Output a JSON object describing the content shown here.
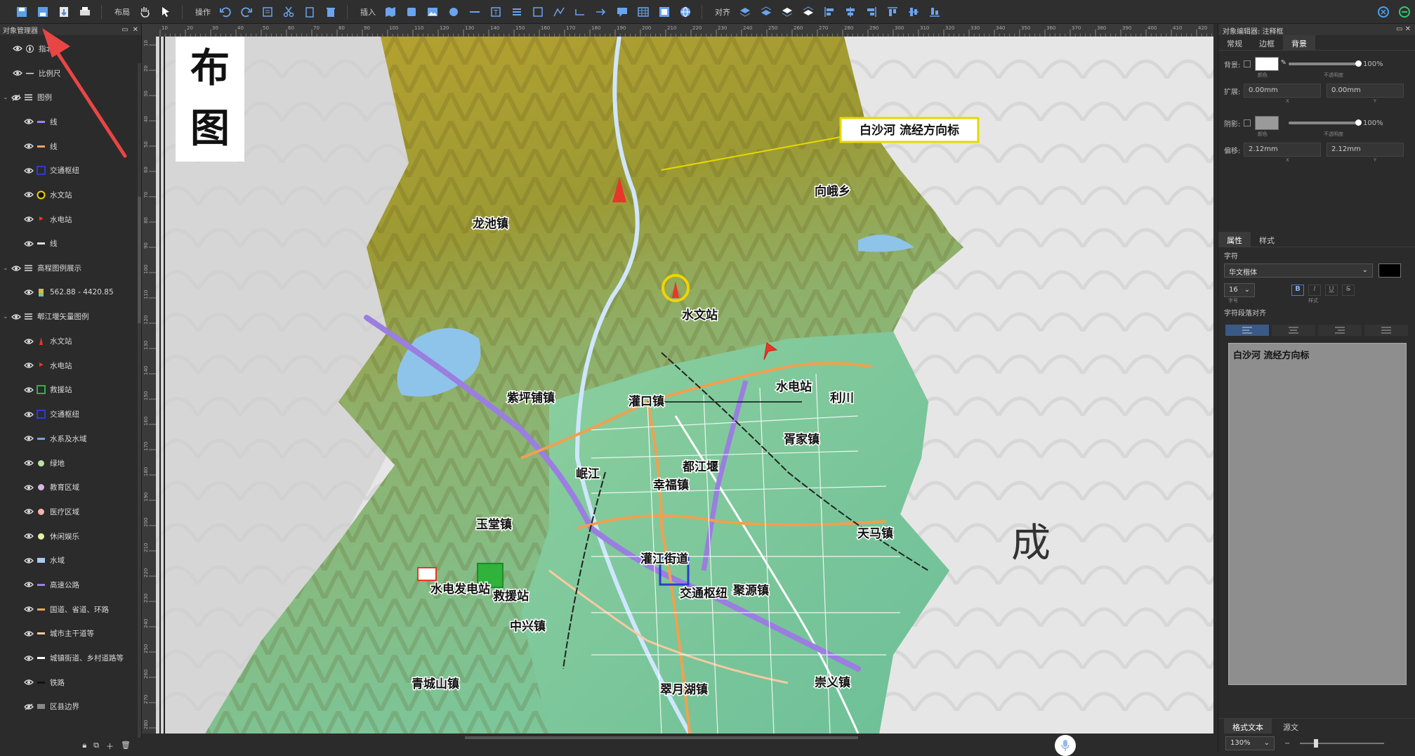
{
  "toolbar": {
    "layout_label": "布局",
    "operate_label": "操作",
    "insert_label": "插入",
    "align_label": "对齐"
  },
  "left_panel": {
    "title": "对象管理器",
    "items": [
      {
        "label": "指北针",
        "icon": "compass-icon",
        "indent": 1,
        "caret": false,
        "swatch": "compass"
      },
      {
        "label": "比例尺",
        "icon": "scalebar-icon",
        "indent": 1,
        "caret": false,
        "swatch": "scale"
      },
      {
        "label": "图例",
        "icon": "legend-icon",
        "indent": 0,
        "caret": true,
        "swatch": "list",
        "hidden": true
      },
      {
        "label": "线",
        "indent": 2,
        "swatch": "line",
        "color": "#9e84ff"
      },
      {
        "label": "线",
        "indent": 2,
        "swatch": "line",
        "color": "#f2a36c"
      },
      {
        "label": "交通枢纽",
        "indent": 2,
        "swatch": "box",
        "color": "#2e3dc7"
      },
      {
        "label": "水文站",
        "indent": 2,
        "swatch": "circle",
        "color": "#f2d400"
      },
      {
        "label": "水电站",
        "indent": 2,
        "swatch": "flag",
        "color": "#e8362a"
      },
      {
        "label": "线",
        "indent": 2,
        "swatch": "line",
        "color": "#dddddd"
      },
      {
        "label": "高程图例展示",
        "indent": 0,
        "caret": true,
        "swatch": "list"
      },
      {
        "label": "562.88 - 4420.85",
        "indent": 2,
        "swatch": "ramp",
        "color": "#d9b93a"
      },
      {
        "label": "郫江堰矢量图例",
        "indent": 0,
        "caret": true,
        "swatch": "list"
      },
      {
        "label": "水文站",
        "indent": 2,
        "swatch": "pin",
        "color": "#e8362a"
      },
      {
        "label": "水电站",
        "indent": 2,
        "swatch": "flag",
        "color": "#e8362a"
      },
      {
        "label": "救援站",
        "indent": 2,
        "swatch": "box",
        "color": "#2fb33b"
      },
      {
        "label": "交通枢纽",
        "indent": 2,
        "swatch": "box",
        "color": "#2e3dc7"
      },
      {
        "label": "水系及水域",
        "indent": 2,
        "swatch": "line",
        "color": "#6fa6e0"
      },
      {
        "label": "绿地",
        "indent": 2,
        "swatch": "dot",
        "color": "#b8e3a0"
      },
      {
        "label": "教育区域",
        "indent": 2,
        "swatch": "dot",
        "color": "#d8b3e6"
      },
      {
        "label": "医疗区域",
        "indent": 2,
        "swatch": "dot",
        "color": "#f3b3a8"
      },
      {
        "label": "休闲娱乐",
        "indent": 2,
        "swatch": "dot",
        "color": "#e7f0a2"
      },
      {
        "label": "水域",
        "indent": 2,
        "swatch": "rect",
        "color": "#a9c9ee"
      },
      {
        "label": "高速公路",
        "indent": 2,
        "swatch": "line",
        "color": "#a07fe0"
      },
      {
        "label": "国道、省道、环路",
        "indent": 2,
        "swatch": "line",
        "color": "#f1a55a"
      },
      {
        "label": "城市主干道等",
        "indent": 2,
        "swatch": "line",
        "color": "#f7c9a0"
      },
      {
        "label": "城镇街道、乡村道路等",
        "indent": 2,
        "swatch": "line",
        "color": "#ffffff"
      },
      {
        "label": "铁路",
        "indent": 2,
        "swatch": "line",
        "color": "#111111"
      },
      {
        "label": "区县边界",
        "indent": 2,
        "swatch": "rect",
        "color": "#888888",
        "hidden": true
      }
    ]
  },
  "ruler_top": [
    "10",
    "20",
    "30",
    "40",
    "50",
    "60",
    "70",
    "80",
    "90",
    "100",
    "110",
    "120",
    "130",
    "140",
    "150",
    "160",
    "170",
    "180",
    "190",
    "200",
    "210",
    "220",
    "230",
    "240",
    "250",
    "260",
    "270",
    "280",
    "290",
    "300",
    "310",
    "320",
    "330",
    "340",
    "350",
    "360",
    "370",
    "380",
    "390",
    "400",
    "410",
    "420"
  ],
  "ruler_left": [
    "10",
    "20",
    "30",
    "40",
    "50",
    "60",
    "70",
    "80",
    "90",
    "100",
    "110",
    "120",
    "130",
    "140",
    "150",
    "160",
    "170",
    "180",
    "190",
    "200",
    "210",
    "220",
    "230",
    "240",
    "250",
    "260",
    "270",
    "280"
  ],
  "map": {
    "title_chars": [
      "布",
      "图"
    ],
    "callout": "白沙河 流经方向标",
    "corner_char": "成",
    "labels": [
      {
        "text": "龙池镇"
      },
      {
        "text": "向峨乡"
      },
      {
        "text": "水文站"
      },
      {
        "text": "紫坪铺镇"
      },
      {
        "text": "灌口镇"
      },
      {
        "text": "水电站"
      },
      {
        "text": "胥家镇"
      },
      {
        "text": "幸福镇"
      },
      {
        "text": "玉堂镇"
      },
      {
        "text": "天马镇"
      },
      {
        "text": "水电发电站"
      },
      {
        "text": "救援站"
      },
      {
        "text": "灌江街道"
      },
      {
        "text": "交通枢纽"
      },
      {
        "text": "聚源镇"
      },
      {
        "text": "中兴镇"
      },
      {
        "text": "青城山镇"
      },
      {
        "text": "翠月湖镇"
      },
      {
        "text": "崇义镇"
      },
      {
        "text": "都江堰"
      },
      {
        "text": "岷江"
      },
      {
        "text": "利川"
      }
    ]
  },
  "right_panel": {
    "title": "对象编辑器: 注释框",
    "tabs": [
      "常规",
      "边框",
      "背景"
    ],
    "active_tab": "背景",
    "bg_label": "背景:",
    "shadow_label": "阴影:",
    "extend_label": "扩展:",
    "offset_label": "偏移:",
    "opacity_value": "100%",
    "shadow_opacity_value": "100%",
    "extend_x": "0.00mm",
    "extend_y": "0.00mm",
    "offset_x": "2.12mm",
    "offset_y": "2.12mm",
    "color_caption": "颜色",
    "opacity_caption": "不透明度",
    "x_caption": "X",
    "y_caption": "Y",
    "tabs2": [
      "属性",
      "样式"
    ],
    "active_tab2": "属性",
    "font_section": "字符",
    "font_name": "华文楷体",
    "font_size": "16",
    "size_caption": "字号",
    "style_caption": "样式",
    "para_section": "字符段落对齐",
    "text_content": "白沙河 流经方向标",
    "foot_tabs": [
      "格式文本",
      "源文"
    ],
    "zoom": "130%"
  },
  "colors": {
    "accent": "#3a5a85",
    "highway": "#9a7ee0",
    "national_road": "#f0a050",
    "arrow": "#e94545"
  }
}
